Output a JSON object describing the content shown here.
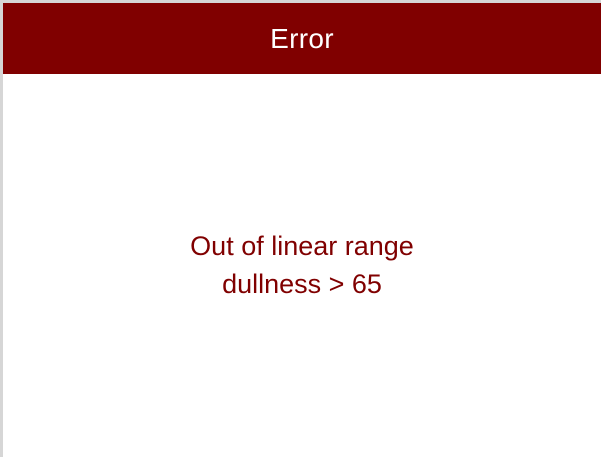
{
  "dialog": {
    "title": "Error",
    "message_lines": [
      "Out of linear range",
      "dullness > 65"
    ]
  },
  "colors": {
    "title_bar": "#800000",
    "title_text": "#ffffff",
    "message_text": "#800000",
    "background": "#ffffff"
  }
}
